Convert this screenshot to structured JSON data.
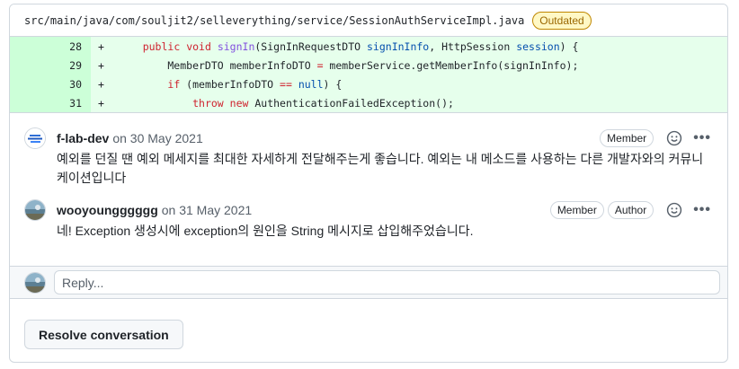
{
  "file": {
    "path": "src/main/java/com/souljit2/selleverything/service/SessionAuthServiceImpl.java",
    "status_badge": "Outdated"
  },
  "diff_lines": [
    {
      "number": "28",
      "marker": "+",
      "code": "    public void signIn(SignInRequestDTO signInInfo, HttpSession session) {"
    },
    {
      "number": "29",
      "marker": "+",
      "code": "        MemberDTO memberInfoDTO = memberService.getMemberInfo(signInInfo);"
    },
    {
      "number": "30",
      "marker": "+",
      "code": "        if (memberInfoDTO == null) {"
    },
    {
      "number": "31",
      "marker": "+",
      "code": "            throw new AuthenticationFailedException();"
    }
  ],
  "comments": [
    {
      "author": "f-lab-dev",
      "date": "on 30 May 2021",
      "badges": [
        "Member"
      ],
      "body": "예외를 던질 땐 예외 메세지를 최대한 자세하게 전달해주는게 좋습니다. 예외는 내 메소드를 사용하는 다른 개발자와의 커뮤니케이션입니다"
    },
    {
      "author": "wooyoungggggg",
      "date": "on 31 May 2021",
      "badges": [
        "Member",
        "Author"
      ],
      "body": "네! Exception 생성시에 exception의 원인을 String 메시지로 삽입해주었습니다."
    }
  ],
  "reply": {
    "placeholder": "Reply..."
  },
  "resolve_label": "Resolve conversation",
  "colors": {
    "diff_bg": "#e6ffec",
    "diff_num_bg": "#ccffd8",
    "outdated": "#9a6700",
    "keyword": "#cf222e",
    "function": "#8250df",
    "constant": "#0550ae"
  },
  "icons": [
    "smiley-icon",
    "kebab-horizontal-icon"
  ]
}
